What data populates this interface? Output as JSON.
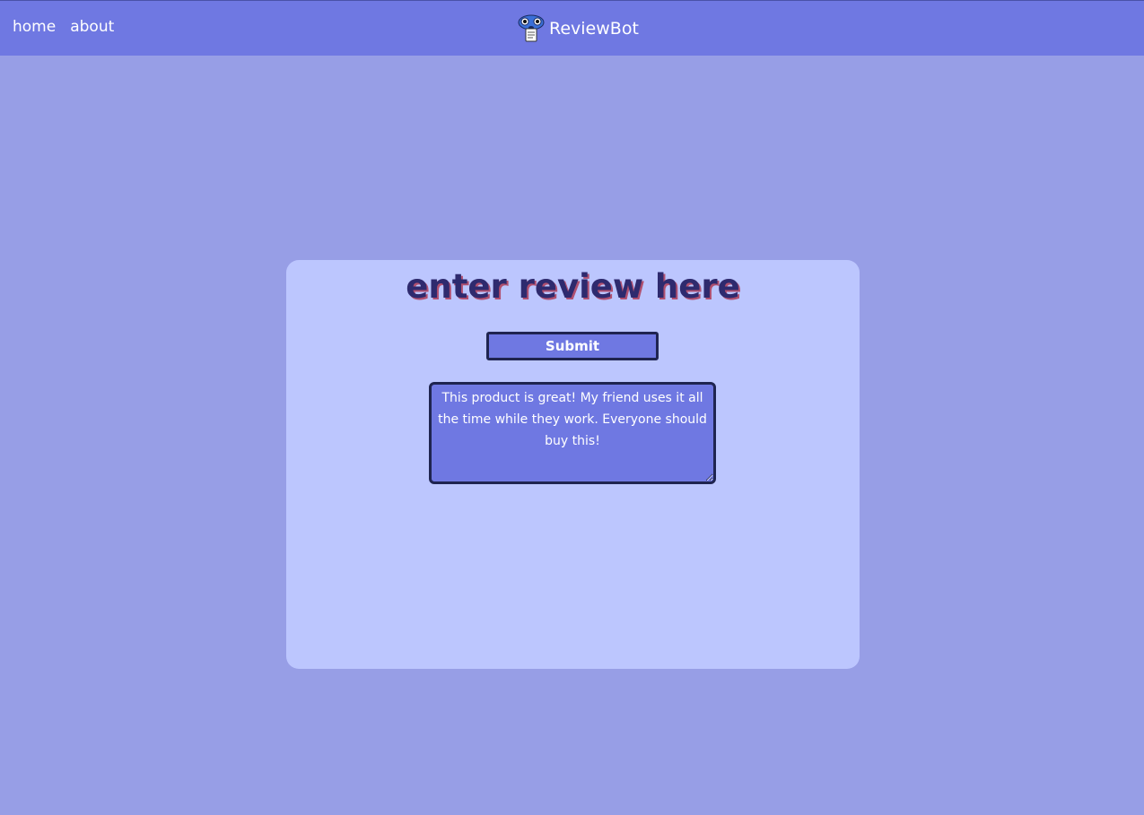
{
  "nav": {
    "links": [
      {
        "label": "home"
      },
      {
        "label": "about"
      }
    ]
  },
  "brand": {
    "title": "ReviewBot",
    "logo_icon": "robot-mascot-icon"
  },
  "review_form": {
    "heading": "enter review here",
    "submit_label": "Submit",
    "review_text": "This product is great! My friend uses it all the time while they work. Everyone should buy this!"
  },
  "colors": {
    "page_background": "#979ee6",
    "topbar_background": "#6f78e2",
    "card_background": "#bcc6fe",
    "accent": "#6f78e2",
    "border_dark": "#1f2450",
    "heading_text": "#2e2a6e"
  }
}
